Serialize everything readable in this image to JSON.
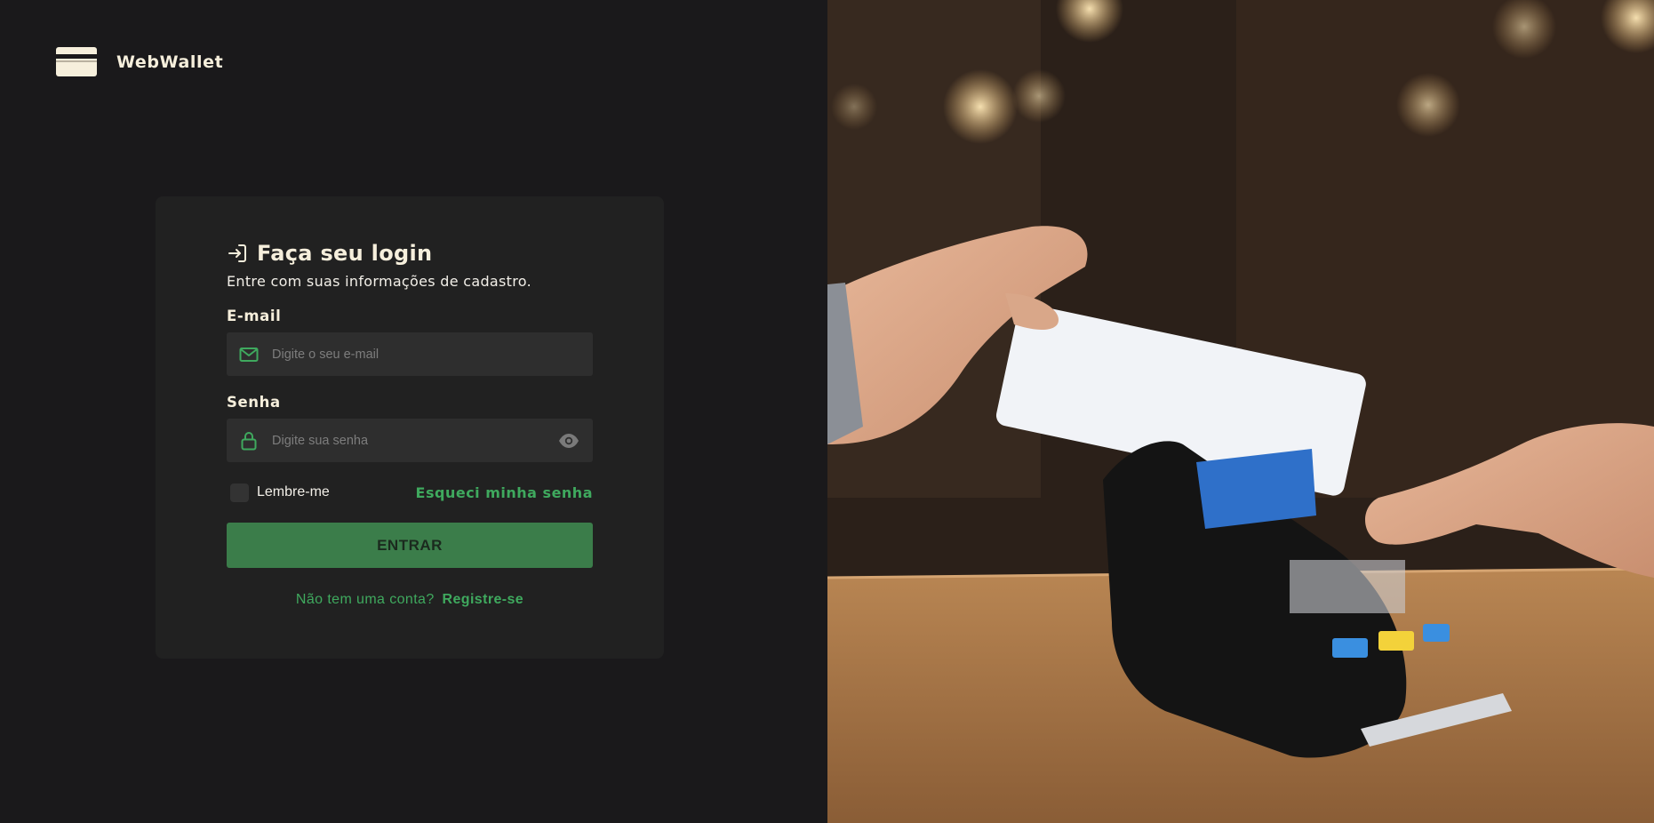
{
  "brand": {
    "name": "WebWallet",
    "logo_icon": "credit-card-icon"
  },
  "login": {
    "icon": "login-arrow-icon",
    "title": "Faça seu login",
    "subtitle": "Entre com suas informações de cadastro.",
    "email": {
      "label": "E-mail",
      "placeholder": "Digite o seu e-mail",
      "value": "",
      "icon": "mail-icon"
    },
    "password": {
      "label": "Senha",
      "placeholder": "Digite sua senha",
      "value": "",
      "icon": "lock-icon",
      "toggle_icon": "eye-icon"
    },
    "remember_label": "Lembre-me",
    "forgot_label": "Esqueci minha senha",
    "submit_label": "ENTRAR",
    "signup_prompt": "Não tem uma conta?",
    "signup_link": "Registre-se"
  },
  "colors": {
    "background": "#1a191b",
    "card": "#212121",
    "accent": "#3fa95e",
    "button": "#3b7d4a",
    "text_cream": "#f6efdc"
  }
}
